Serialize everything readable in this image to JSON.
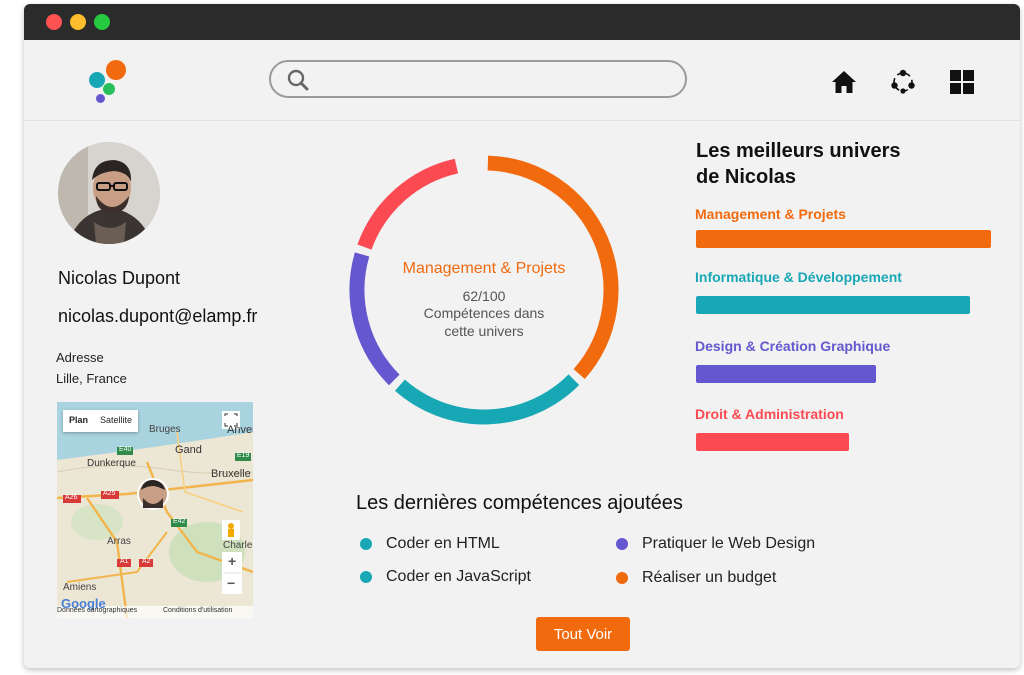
{
  "colors": {
    "orange": "#f26a0e",
    "teal": "#18a7b5",
    "purple": "#6457d0",
    "red": "#fb4a52",
    "titlebar": "#2b2b2b"
  },
  "header": {
    "logo_icon": "elamp-logo",
    "search": {
      "placeholder": "",
      "value": ""
    },
    "icons": [
      "home-icon",
      "network-icon",
      "grid-icon"
    ]
  },
  "profile": {
    "name": "Nicolas Dupont",
    "email": "nicolas.dupont@elamp.fr",
    "address_label": "Adresse",
    "address_value": "Lille, France",
    "map": {
      "tab_plan": "Plan",
      "tab_satellite": "Satellite",
      "labels": [
        "Bruges",
        "Gand",
        "Dunkerque",
        "Bruxelle",
        "Anver",
        "Arras",
        "Amiens",
        "Charle"
      ],
      "road_labels": [
        "E40",
        "E19",
        "A26",
        "A25",
        "E42",
        "A1",
        "A2"
      ],
      "zoom_in": "+",
      "zoom_out": "−",
      "footer_data": "Données cartographiques",
      "footer_terms": "Conditions d'utilisation",
      "google": "Google"
    }
  },
  "donut": {
    "center_title": "Management & Projets",
    "score": "62/100",
    "subtitle_line1": "Compétences dans",
    "subtitle_line2": "cette univers",
    "segments": [
      {
        "color": "#f26a0e",
        "share": 0.37
      },
      {
        "color": "#18a7b5",
        "share": 0.25
      },
      {
        "color": "#6457d0",
        "share": 0.18
      },
      {
        "color": "#fb4a52",
        "share": 0.17
      }
    ]
  },
  "best": {
    "title_line1": "Les meilleurs univers",
    "title_line2": "de Nicolas",
    "items": [
      {
        "label": "Management & Projets",
        "color": "#f26a0e",
        "value": 1.0
      },
      {
        "label": "Informatique & Développement",
        "color": "#18a7b5",
        "value": 0.93
      },
      {
        "label": "Design & Création Graphique",
        "color": "#6457d0",
        "value": 0.61
      },
      {
        "label": "Droit & Administration",
        "color": "#fb4a52",
        "value": 0.52
      }
    ]
  },
  "recent": {
    "title": "Les dernières compétences ajoutées",
    "skills": [
      {
        "label": "Coder en HTML",
        "color": "#18a7b5"
      },
      {
        "label": "Coder en JavaScript",
        "color": "#18a7b5"
      },
      {
        "label": "Pratiquer le Web Design",
        "color": "#6457d0"
      },
      {
        "label": "Réaliser un budget",
        "color": "#f26a0e"
      }
    ],
    "button": "Tout Voir"
  }
}
